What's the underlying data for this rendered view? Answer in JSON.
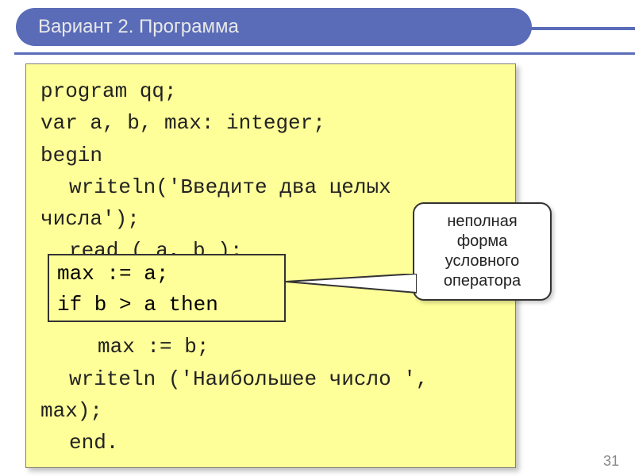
{
  "slide": {
    "title": "Вариант 2. Программа",
    "page_number": "31"
  },
  "code": {
    "l1": "program qq;",
    "l2": "var a, b, max: integer;",
    "l3": "begin",
    "l4": "writeln('Введите два целых",
    "l5": "числа');",
    "l6": "read ( a, b );",
    "l7a": "max := a;",
    "l7b": "if b > a then",
    "l8": "max := b;",
    "l9": "writeln ('Наибольшее число ',",
    "l10": "max);",
    "l11": "end."
  },
  "callout": {
    "text": "неполная форма условного оператора"
  }
}
